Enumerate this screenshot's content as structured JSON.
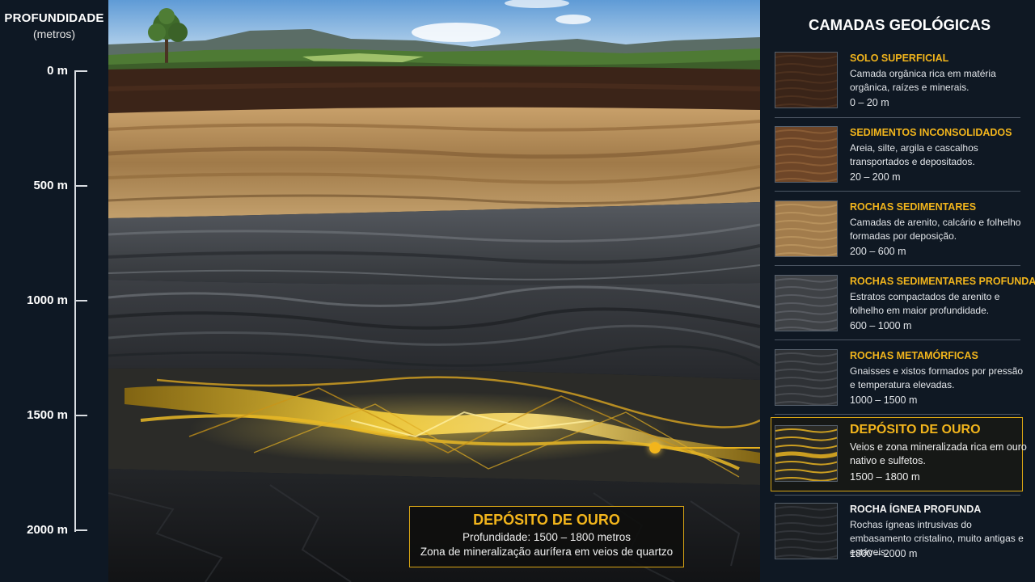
{
  "depth_scale": {
    "title": "PROFUNDIDADE",
    "unit": "(metros)",
    "ticks": [
      {
        "label": "0 m",
        "value": 0
      },
      {
        "label": "500 m",
        "value": 500
      },
      {
        "label": "1000 m",
        "value": 1000
      },
      {
        "label": "1500 m",
        "value": 1500
      },
      {
        "label": "2000 m",
        "value": 2000
      }
    ]
  },
  "callout": {
    "title": "DEPÓSITO DE OURO",
    "line1": "Profundidade: 1500 – 1800 metros",
    "line2": "Zona de mineralização aurífera em veios de quartzo"
  },
  "legend": {
    "title": "CAMADAS GEOLÓGICAS",
    "layers": [
      {
        "name": "SOLO SUPERFICIAL",
        "desc": "Camada orgânica rica em matéria orgânica, raízes e minerais.",
        "range": "0 – 20 m",
        "swatch_base": "#3a2418",
        "swatch_accent": "#5b3a25"
      },
      {
        "name": "SEDIMENTOS INCONSOLIDADOS",
        "desc": "Areia, silte, argila e cascalhos transportados e depositados.",
        "range": "20 – 200 m",
        "swatch_base": "#6e4628",
        "swatch_accent": "#a0703f"
      },
      {
        "name": "ROCHAS SEDIMENTARES",
        "desc": "Camadas de arenito, calcário e folhelho formadas por deposição.",
        "range": "200 – 600 m",
        "swatch_base": "#a27c4c",
        "swatch_accent": "#c9a36a"
      },
      {
        "name": "ROCHAS SEDIMENTARES PROFUNDAS",
        "desc": "Estratos compactados de arenito e folhelho em maior profundidade.",
        "range": "600 – 1000 m",
        "swatch_base": "#3f4246",
        "swatch_accent": "#6c7076"
      },
      {
        "name": "ROCHAS METAMÓRFICAS",
        "desc": "Gnaisses e xistos formados por pressão e temperatura elevadas.",
        "range": "1000 – 1500 m",
        "swatch_base": "#2f3236",
        "swatch_accent": "#5b5f64"
      },
      {
        "name": "DEPÓSITO DE OURO",
        "desc": "Veios e zona mineralizada rica em ouro nativo e sulfetos.",
        "range": "1500 – 1800 m",
        "swatch_base": "#2a2a26",
        "swatch_accent": "#e7b321",
        "highlight": true
      },
      {
        "name": "ROCHA ÍGNEA PROFUNDA",
        "desc": "Rochas ígneas intrusivas do embasamento cristalino, muito antigas e estáveis.",
        "range": "1800 – 2000 m",
        "swatch_base": "#1e2124",
        "swatch_accent": "#42464b"
      }
    ]
  },
  "colors": {
    "accent_gold": "#f2b51c",
    "panel_bg": "#0f1823",
    "sky": "#8fbbe6",
    "topsoil": "#3b2418",
    "sandstone": "#b08a57",
    "shale": "#3e4247",
    "metamorphic": "#2b2e33",
    "igneous": "#1a1c1f"
  }
}
